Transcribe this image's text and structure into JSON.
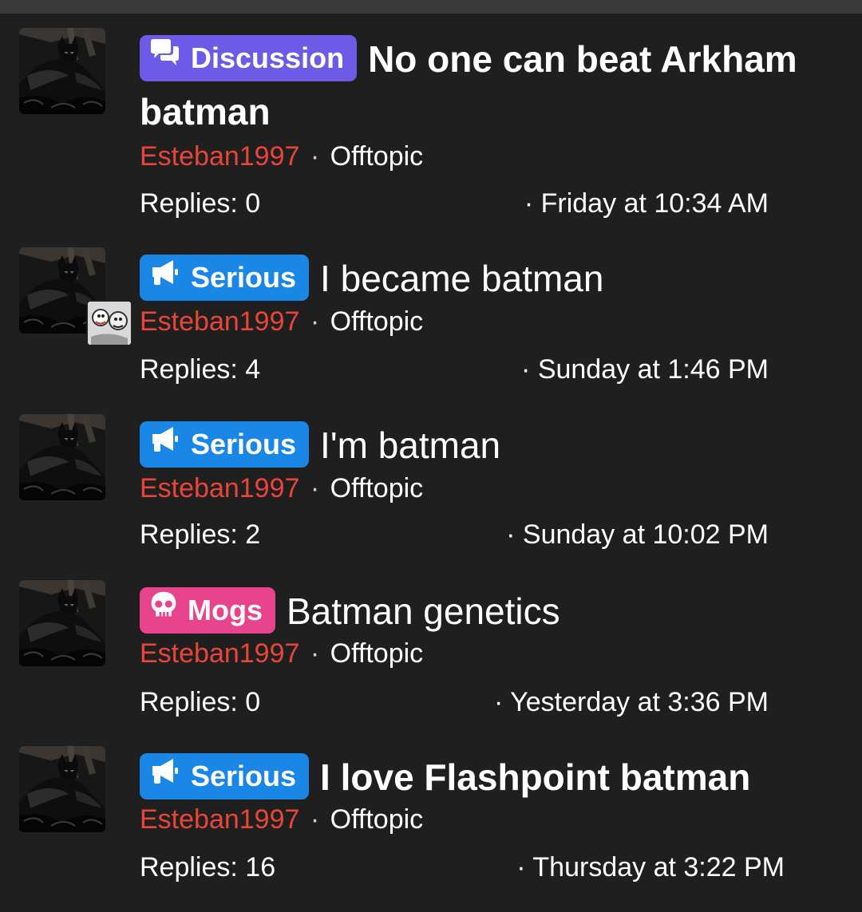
{
  "threads": [
    {
      "prefix": "Discussion",
      "prefix_color": "#6d5ae6",
      "prefix_icon": "chat-bubbles-icon",
      "title": "No one can beat Arkham batman",
      "title_style": "bold",
      "author": "Esteban1997",
      "separator": "·",
      "forum": "Offtopic",
      "replies": "Replies: 0",
      "date": "· Friday at 10:34 AM"
    },
    {
      "prefix": "Serious",
      "prefix_color": "#1a87e6",
      "prefix_icon": "megaphone-icon",
      "title": "I became batman",
      "title_style": "normal",
      "author": "Esteban1997",
      "separator": "·",
      "forum": "Offtopic",
      "replies": "Replies: 4",
      "date": "· Sunday at 1:46 PM"
    },
    {
      "prefix": "Serious",
      "prefix_color": "#1a87e6",
      "prefix_icon": "megaphone-icon",
      "title": "I'm batman",
      "title_style": "normal",
      "author": "Esteban1997",
      "separator": "·",
      "forum": "Offtopic",
      "replies": "Replies: 2",
      "date": "· Sunday at 10:02 PM"
    },
    {
      "prefix": "Mogs",
      "prefix_color": "#e8448e",
      "prefix_icon": "skull-icon",
      "title": "Batman genetics",
      "title_style": "normal",
      "author": "Esteban1997",
      "separator": "·",
      "forum": "Offtopic",
      "replies": "Replies: 0",
      "date": "· Yesterday at 3:36 PM"
    },
    {
      "prefix": "Serious",
      "prefix_color": "#1a87e6",
      "prefix_icon": "megaphone-icon",
      "title": "I love Flashpoint batman",
      "title_style": "bold",
      "author": "Esteban1997",
      "separator": "·",
      "forum": "Offtopic",
      "replies": "Replies: 16",
      "date": "· Thursday at 3:22 PM"
    }
  ],
  "colors": {
    "background": "#1f1f1f",
    "author": "#e8453b",
    "text": "#ffffff"
  }
}
